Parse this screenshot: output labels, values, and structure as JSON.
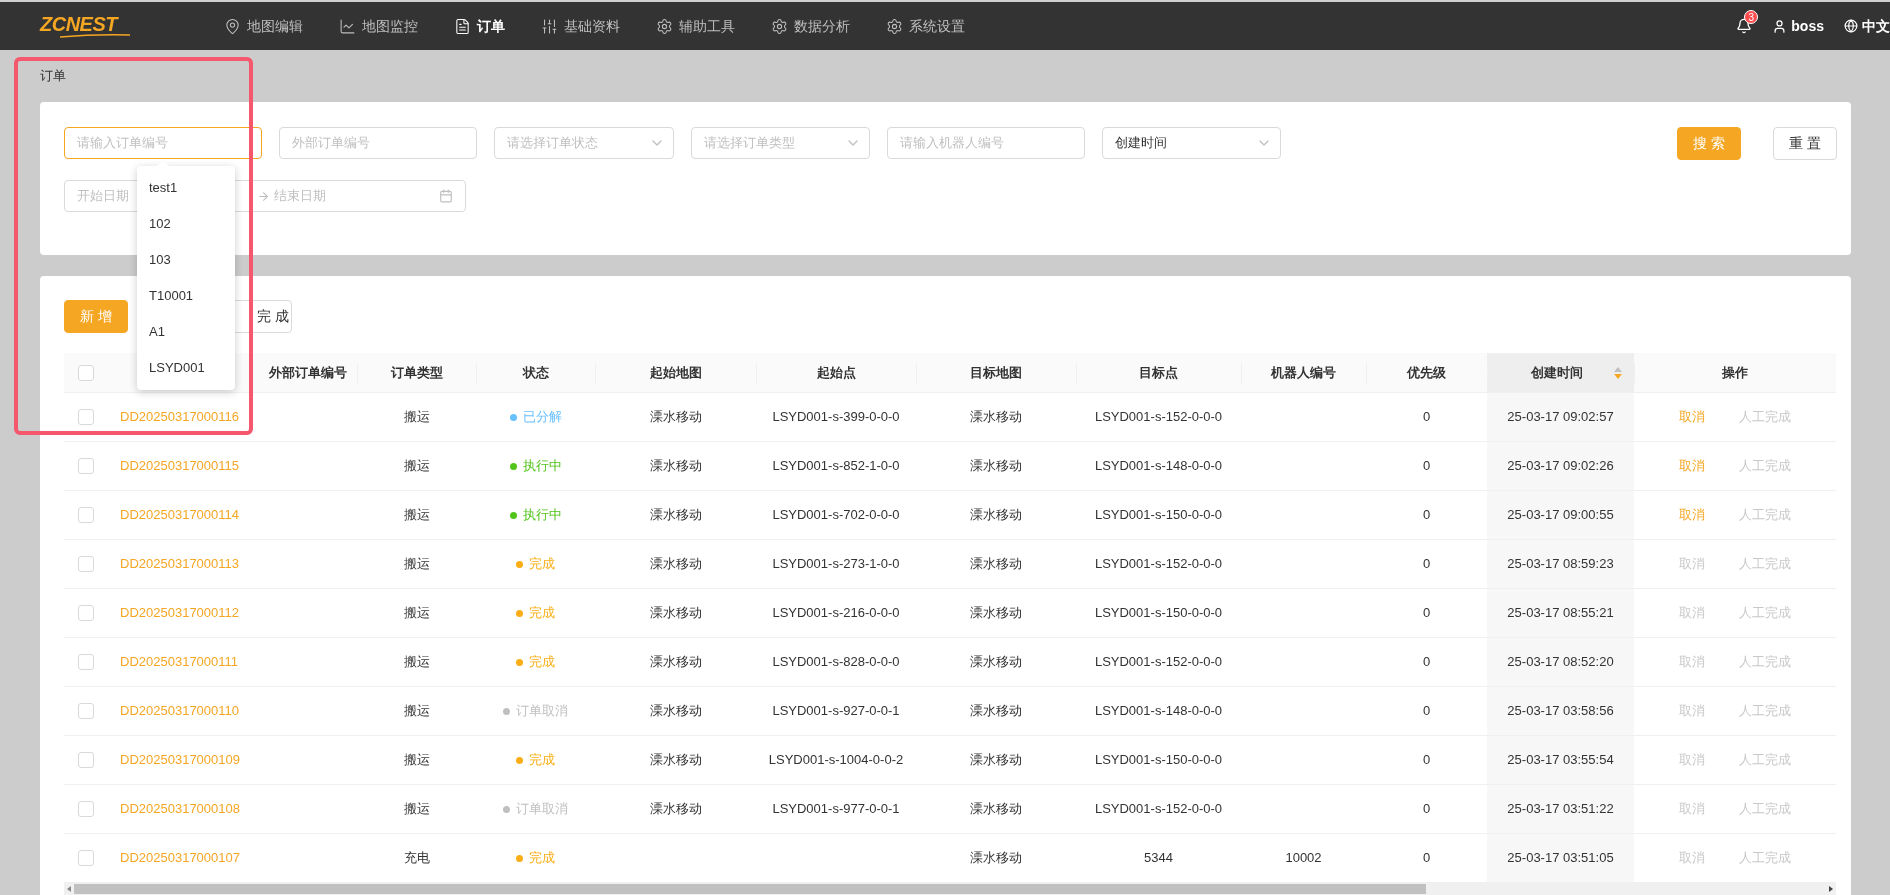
{
  "nav": {
    "logo": "ZCNEST",
    "items": [
      {
        "label": "地图编辑",
        "selected": false
      },
      {
        "label": "地图监控",
        "selected": false
      },
      {
        "label": "订单",
        "selected": true
      },
      {
        "label": "基础资料",
        "selected": false
      },
      {
        "label": "辅助工具",
        "selected": false
      },
      {
        "label": "数据分析",
        "selected": false
      },
      {
        "label": "系统设置",
        "selected": false
      }
    ],
    "notification_count": "3",
    "user": "boss",
    "language": "中文"
  },
  "breadcrumb": "订单",
  "filters": {
    "fields": [
      {
        "kind": "input",
        "placeholder": "请输入订单编号",
        "focused": true
      },
      {
        "kind": "input",
        "placeholder": "外部订单编号",
        "focused": false
      },
      {
        "kind": "select",
        "placeholder": "请选择订单状态",
        "focused": false
      },
      {
        "kind": "select",
        "placeholder": "请选择订单类型",
        "focused": false
      },
      {
        "kind": "input",
        "placeholder": "请输入机器人编号",
        "focused": false
      },
      {
        "kind": "select",
        "value": "创建时间",
        "focused": false
      }
    ],
    "date_range": {
      "start_placeholder": "开始日期",
      "end_placeholder": "结束日期"
    },
    "buttons": [
      {
        "label": "搜 索",
        "kind": "primary"
      },
      {
        "label": "重 置",
        "kind": "default"
      }
    ]
  },
  "autocomplete": {
    "options": [
      "test1",
      "102",
      "103",
      "T10001",
      "A1",
      "LSYD001"
    ]
  },
  "toolbar": {
    "buttons": [
      {
        "label": "新 增",
        "kind": "primary"
      },
      {
        "label": "完 成",
        "kind": "default"
      }
    ]
  },
  "table": {
    "all_checked": false,
    "columns": [
      {
        "label": "外部订单编号"
      },
      {
        "label": "订单类型"
      },
      {
        "label": "状态"
      },
      {
        "label": "起始地图"
      },
      {
        "label": "起始点"
      },
      {
        "label": "目标地图"
      },
      {
        "label": "目标点"
      },
      {
        "label": "机器人编号"
      },
      {
        "label": "优先级"
      },
      {
        "label": "创建时间",
        "sorted": true
      },
      {
        "label": "操作"
      }
    ],
    "rows": [
      {
        "checked": false,
        "order_no": "DD20250317000116",
        "type": "搬运",
        "status": {
          "label": "已分解",
          "color": "#69c0ff"
        },
        "start_map": "溧水移动",
        "start_point": "LSYD001-s-399-0-0-0",
        "target_map": "溧水移动",
        "target_point": "LSYD001-s-152-0-0-0",
        "priority": "0",
        "created": "25-03-17 09:02:57",
        "actions": [
          {
            "label": "取消",
            "disabled": false
          },
          {
            "label": "人工完成",
            "disabled": true
          }
        ]
      },
      {
        "checked": false,
        "order_no": "DD20250317000115",
        "type": "搬运",
        "status": {
          "label": "执行中",
          "color": "#52c41a"
        },
        "start_map": "溧水移动",
        "start_point": "LSYD001-s-852-1-0-0",
        "target_map": "溧水移动",
        "target_point": "LSYD001-s-148-0-0-0",
        "priority": "0",
        "created": "25-03-17 09:02:26",
        "actions": [
          {
            "label": "取消",
            "disabled": false
          },
          {
            "label": "人工完成",
            "disabled": true
          }
        ]
      },
      {
        "checked": false,
        "order_no": "DD20250317000114",
        "type": "搬运",
        "status": {
          "label": "执行中",
          "color": "#52c41a"
        },
        "start_map": "溧水移动",
        "start_point": "LSYD001-s-702-0-0-0",
        "target_map": "溧水移动",
        "target_point": "LSYD001-s-150-0-0-0",
        "priority": "0",
        "created": "25-03-17 09:00:55",
        "actions": [
          {
            "label": "取消",
            "disabled": false
          },
          {
            "label": "人工完成",
            "disabled": true
          }
        ]
      },
      {
        "checked": false,
        "order_no": "DD20250317000113",
        "type": "搬运",
        "status": {
          "label": "完成",
          "color": "#faad14"
        },
        "start_map": "溧水移动",
        "start_point": "LSYD001-s-273-1-0-0",
        "target_map": "溧水移动",
        "target_point": "LSYD001-s-152-0-0-0",
        "priority": "0",
        "created": "25-03-17 08:59:23",
        "actions": [
          {
            "label": "取消",
            "disabled": true
          },
          {
            "label": "人工完成",
            "disabled": true
          }
        ]
      },
      {
        "checked": false,
        "order_no": "DD20250317000112",
        "type": "搬运",
        "status": {
          "label": "完成",
          "color": "#faad14"
        },
        "start_map": "溧水移动",
        "start_point": "LSYD001-s-216-0-0-0",
        "target_map": "溧水移动",
        "target_point": "LSYD001-s-150-0-0-0",
        "priority": "0",
        "created": "25-03-17 08:55:21",
        "actions": [
          {
            "label": "取消",
            "disabled": true
          },
          {
            "label": "人工完成",
            "disabled": true
          }
        ]
      },
      {
        "checked": false,
        "order_no": "DD20250317000111",
        "type": "搬运",
        "status": {
          "label": "完成",
          "color": "#faad14"
        },
        "start_map": "溧水移动",
        "start_point": "LSYD001-s-828-0-0-0",
        "target_map": "溧水移动",
        "target_point": "LSYD001-s-152-0-0-0",
        "priority": "0",
        "created": "25-03-17 08:52:20",
        "actions": [
          {
            "label": "取消",
            "disabled": true
          },
          {
            "label": "人工完成",
            "disabled": true
          }
        ]
      },
      {
        "checked": false,
        "order_no": "DD20250317000110",
        "type": "搬运",
        "status": {
          "label": "订单取消",
          "color": "#bfbfbf"
        },
        "start_map": "溧水移动",
        "start_point": "LSYD001-s-927-0-0-1",
        "target_map": "溧水移动",
        "target_point": "LSYD001-s-148-0-0-0",
        "priority": "0",
        "created": "25-03-17 03:58:56",
        "actions": [
          {
            "label": "取消",
            "disabled": true
          },
          {
            "label": "人工完成",
            "disabled": true
          }
        ]
      },
      {
        "checked": false,
        "order_no": "DD20250317000109",
        "type": "搬运",
        "status": {
          "label": "完成",
          "color": "#faad14"
        },
        "start_map": "溧水移动",
        "start_point": "LSYD001-s-1004-0-0-2",
        "target_map": "溧水移动",
        "target_point": "LSYD001-s-150-0-0-0",
        "priority": "0",
        "created": "25-03-17 03:55:54",
        "actions": [
          {
            "label": "取消",
            "disabled": true
          },
          {
            "label": "人工完成",
            "disabled": true
          }
        ]
      },
      {
        "checked": false,
        "order_no": "DD20250317000108",
        "type": "搬运",
        "status": {
          "label": "订单取消",
          "color": "#bfbfbf"
        },
        "start_map": "溧水移动",
        "start_point": "LSYD001-s-977-0-0-1",
        "target_map": "溧水移动",
        "target_point": "LSYD001-s-152-0-0-0",
        "priority": "0",
        "created": "25-03-17 03:51:22",
        "actions": [
          {
            "label": "取消",
            "disabled": true
          },
          {
            "label": "人工完成",
            "disabled": true
          }
        ]
      },
      {
        "checked": false,
        "order_no": "DD20250317000107",
        "type": "充电",
        "status": {
          "label": "完成",
          "color": "#faad14"
        },
        "target_map": "溧水移动",
        "target_point": "5344",
        "robot": "10002",
        "priority": "0",
        "created": "25-03-17 03:51:05",
        "actions": [
          {
            "label": "取消",
            "disabled": true
          },
          {
            "label": "人工完成",
            "disabled": true
          }
        ]
      }
    ]
  }
}
